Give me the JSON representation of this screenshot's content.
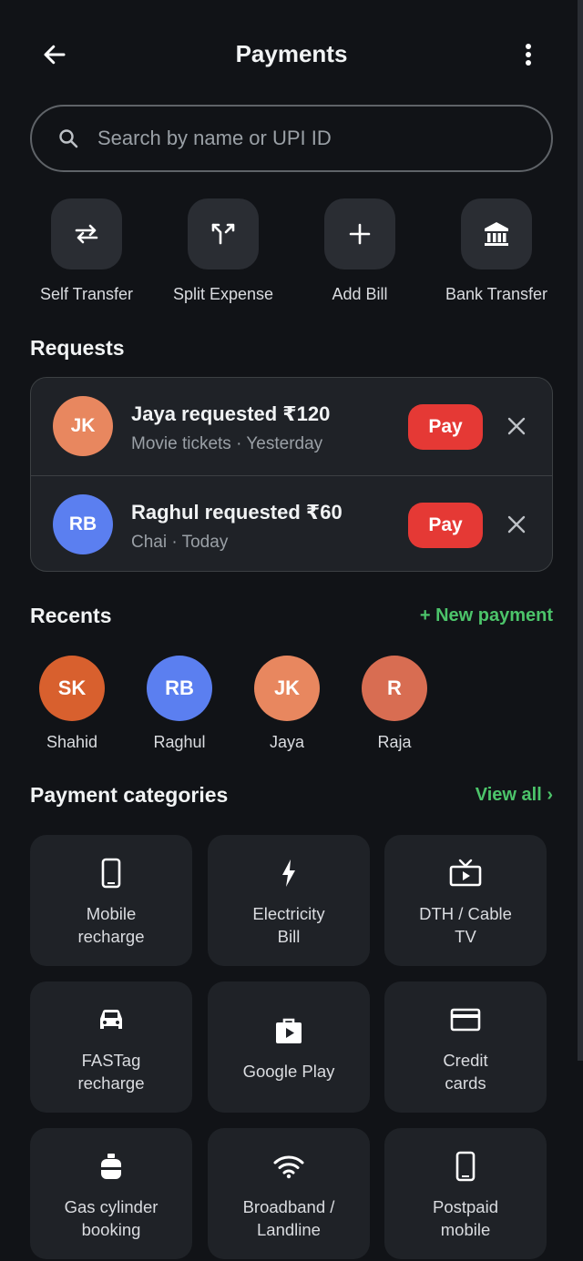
{
  "header": {
    "title": "Payments"
  },
  "search": {
    "placeholder": "Search by name or UPI ID"
  },
  "quick_actions": [
    {
      "label": "Self Transfer",
      "icon": "swap-arrows-icon"
    },
    {
      "label": "Split Expense",
      "icon": "split-arrows-icon"
    },
    {
      "label": "Add Bill",
      "icon": "plus-icon"
    },
    {
      "label": "Bank Transfer",
      "icon": "bank-icon"
    }
  ],
  "requests": {
    "title": "Requests",
    "items": [
      {
        "initials": "JK",
        "avatar_color": "#e8875f",
        "title": "Jaya requested ₹120",
        "subtitle": "Movie tickets · Yesterday",
        "pay_label": "Pay"
      },
      {
        "initials": "RB",
        "avatar_color": "#5b7ff0",
        "title": "Raghul requested ₹60",
        "subtitle": "Chai · Today",
        "pay_label": "Pay"
      }
    ]
  },
  "recents": {
    "title": "Recents",
    "new_payment_label": "+ New payment",
    "people": [
      {
        "initials": "SK",
        "name": "Shahid",
        "color": "#d8602e"
      },
      {
        "initials": "RB",
        "name": "Raghul",
        "color": "#5b7ff0"
      },
      {
        "initials": "JK",
        "name": "Jaya",
        "color": "#e8875f"
      },
      {
        "initials": "R",
        "name": "Raja",
        "color": "#d86d52"
      }
    ]
  },
  "categories": {
    "title": "Payment categories",
    "view_all_label": "View all ›",
    "items": [
      {
        "line1": "Mobile",
        "line2": "recharge",
        "icon": "smartphone-icon"
      },
      {
        "line1": "Electricity",
        "line2": "Bill",
        "icon": "lightning-icon"
      },
      {
        "line1": "DTH / Cable",
        "line2": "TV",
        "icon": "tv-icon"
      },
      {
        "line1": "FASTag",
        "line2": "recharge",
        "icon": "car-icon"
      },
      {
        "line1": "Google Play",
        "line2": "",
        "icon": "google-play-bag-icon"
      },
      {
        "line1": "Credit",
        "line2": "cards",
        "icon": "credit-card-icon"
      },
      {
        "line1": "Gas cylinder",
        "line2": "booking",
        "icon": "gas-cylinder-icon"
      },
      {
        "line1": "Broadband /",
        "line2": "Landline",
        "icon": "wifi-icon"
      },
      {
        "line1": "Postpaid",
        "line2": "mobile",
        "icon": "smartphone-icon"
      }
    ]
  },
  "colors": {
    "background": "#111317",
    "card": "#1f2227",
    "accent_green": "#4cc46a",
    "pay_red": "#e53935"
  }
}
